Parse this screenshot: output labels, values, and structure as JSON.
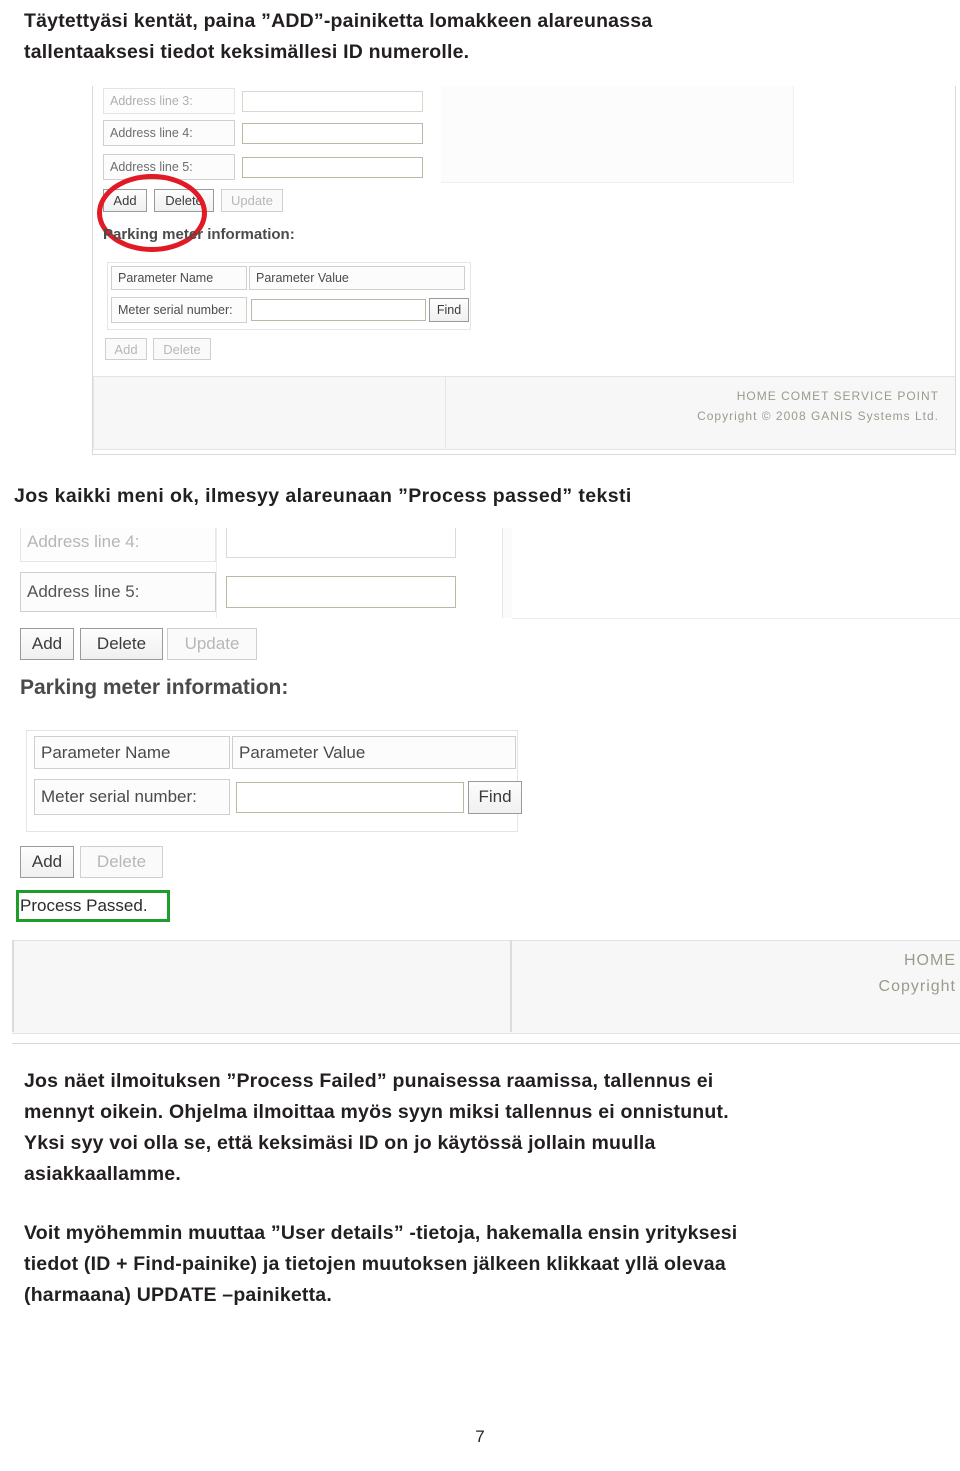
{
  "document": {
    "intro": {
      "line1": "Täytettyäsi kentät, paina ”ADD”-painiketta lomakkeen alareunassa",
      "line2": "tallentaaksesi tiedot keksimällesi ID numerolle."
    },
    "heading_ok": "Jos kaikki meni ok, ilmesyy alareunaan ”Process passed” teksti",
    "failed_block": {
      "line1": "Jos näet ilmoituksen ”Process Failed” punaisessa raamissa, tallennus ei",
      "line2": "mennyt oikein. Ohjelma ilmoittaa myös syyn miksi tallennus ei onnistunut.",
      "line3": "Yksi syy voi olla se, että keksimäsi ID on jo käytössä jollain muulla",
      "line4": "asiakkaallamme."
    },
    "update_block": {
      "line1": "Voit myöhemmin muuttaa ”User details” -tietoja, hakemalla ensin yrityksesi",
      "line2": "tiedot (ID + Find-painike) ja tietojen muutoksen jälkeen klikkaat yllä olevaa",
      "line3": "(harmaana) UPDATE –painiketta."
    },
    "page_number": "7"
  },
  "screenshot1": {
    "fields": [
      {
        "label": "Address line 3:",
        "value": ""
      },
      {
        "label": "Address line 4:",
        "value": ""
      },
      {
        "label": "Address line 5:",
        "value": ""
      }
    ],
    "buttons": {
      "add": "Add",
      "delete": "Delete",
      "update": "Update"
    },
    "section_title": "Parking meter information:",
    "table_headers": {
      "name": "Parameter Name",
      "value": "Parameter Value"
    },
    "meter_row": {
      "label": "Meter serial number:",
      "value": "",
      "find": "Find"
    },
    "bottom_buttons": {
      "add": "Add",
      "delete": "Delete"
    },
    "footer": {
      "links": "HOME    COMET SERVICE POINT",
      "copyright": "Copyright © 2008 GANIS Systems Ltd."
    }
  },
  "screenshot2": {
    "fields": [
      {
        "label": "Address line 4:",
        "value": ""
      },
      {
        "label": "Address line 5:",
        "value": ""
      }
    ],
    "buttons": {
      "add": "Add",
      "delete": "Delete",
      "update": "Update"
    },
    "section_title": "Parking meter information:",
    "table_headers": {
      "name": "Parameter Name",
      "value": "Parameter Value"
    },
    "meter_row": {
      "label": "Meter serial number:",
      "value": "",
      "find": "Find"
    },
    "bottom_buttons": {
      "add": "Add",
      "delete": "Delete"
    },
    "status_message": "Process Passed.",
    "footer": {
      "home": "HOME",
      "copyright": "Copyright"
    }
  },
  "colors": {
    "highlight_red": "#e01b24",
    "highlight_green": "#1f9c2a",
    "text": "#231f20"
  }
}
